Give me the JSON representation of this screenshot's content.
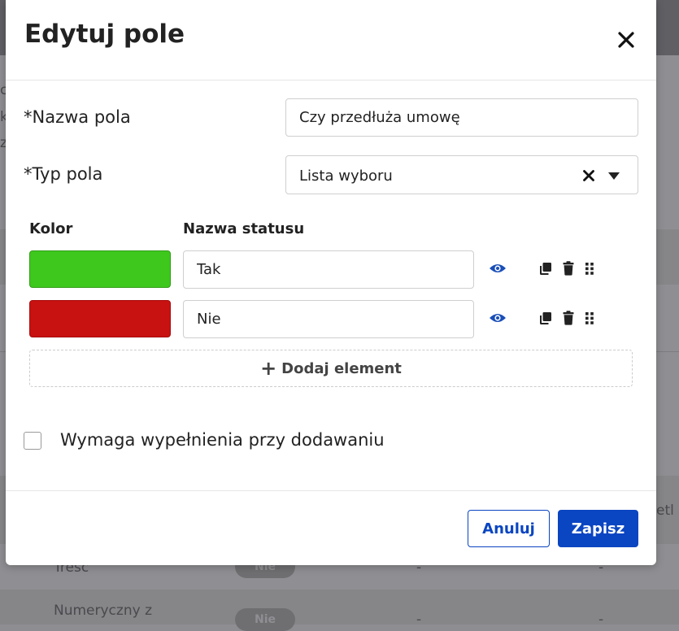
{
  "modal": {
    "title": "Edytuj pole",
    "field_name_label": "*Nazwa pola",
    "field_name_value": "Czy przedłuża umowę",
    "field_type_label": "*Typ pola",
    "field_type_value": "Lista wyboru",
    "color_header": "Kolor",
    "status_name_header": "Nazwa statusu",
    "statuses": [
      {
        "name": "Tak",
        "color": "#3ec81e"
      },
      {
        "name": "Nie",
        "color": "#c81111"
      }
    ],
    "add_element_label": "Dodaj element",
    "required_label": "Wymaga wypełnienia przy dodawaniu",
    "required_checked": false,
    "cancel_label": "Anuluj",
    "save_label": "Zapisz"
  },
  "colors": {
    "accent": "#0a45c2",
    "icon_blue": "#1a4fb8"
  },
  "background": {
    "left_fragments": [
      "c",
      "k",
      "z"
    ],
    "right_fragment": "etl p",
    "rows": [
      {
        "name": "Tresc",
        "badge": "Nie",
        "col3": "-",
        "col4": "-"
      },
      {
        "name": "Numeryczny z",
        "badge": "Nie",
        "col3": "-",
        "col4": "-"
      }
    ]
  }
}
